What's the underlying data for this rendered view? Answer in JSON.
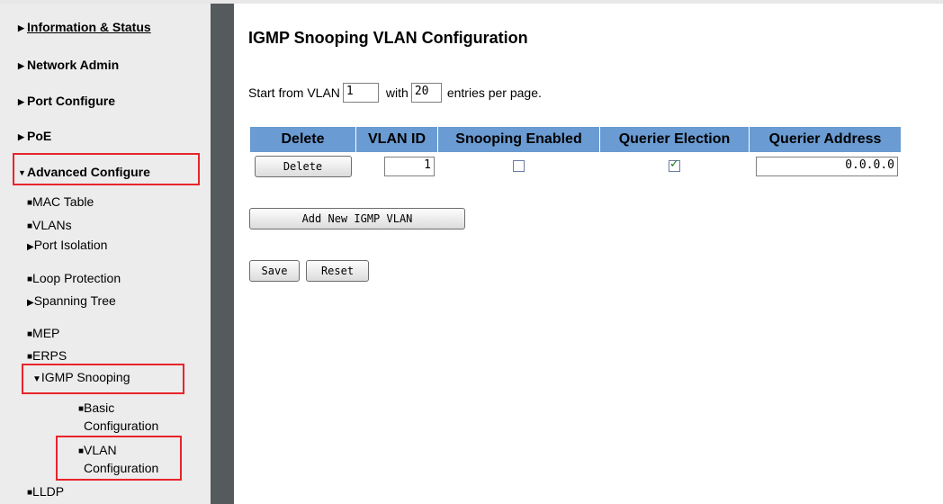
{
  "sidebar": {
    "main_items": [
      {
        "label": "Information & Status"
      },
      {
        "label": "Network Admin"
      },
      {
        "label": "Port Configure"
      },
      {
        "label": "PoE"
      },
      {
        "label": "Advanced Configure"
      }
    ],
    "sub_items": [
      {
        "label": "MAC Table",
        "marker": "bullet"
      },
      {
        "label": "VLANs",
        "marker": "bullet"
      },
      {
        "label": "Port Isolation",
        "marker": "arrow"
      },
      {
        "label": "Loop Protection",
        "marker": "bullet"
      },
      {
        "label": "Spanning Tree",
        "marker": "arrow"
      },
      {
        "label": "MEP",
        "marker": "bullet"
      },
      {
        "label": "ERPS",
        "marker": "bullet"
      },
      {
        "label": "IGMP Snooping",
        "marker": "arrow-down"
      },
      {
        "label": "LLDP",
        "marker": "bullet"
      }
    ],
    "igmp_children": [
      {
        "line1": "Basic",
        "line2": "Configuration"
      },
      {
        "line1": "VLAN",
        "line2": "Configuration"
      }
    ]
  },
  "main": {
    "title": "IGMP Snooping VLAN Configuration",
    "paging": {
      "prefix": "Start from VLAN",
      "start_value": "1",
      "middle": "with",
      "entries_value": "20",
      "suffix": "entries per page."
    },
    "table": {
      "headers": [
        "Delete",
        "VLAN ID",
        "Snooping Enabled",
        "Querier Election",
        "Querier Address"
      ],
      "rows": [
        {
          "delete_label": "Delete",
          "vlan_id": "1",
          "snooping_enabled": false,
          "querier_election": true,
          "querier_address": "0.0.0.0"
        }
      ]
    },
    "add_button": "Add New IGMP VLAN",
    "save_button": "Save",
    "reset_button": "Reset"
  },
  "colors": {
    "header_bg": "#6a9bd2",
    "highlight": "#e8242a",
    "sidebar_bg": "#ececec",
    "divider": "#555a5d"
  }
}
